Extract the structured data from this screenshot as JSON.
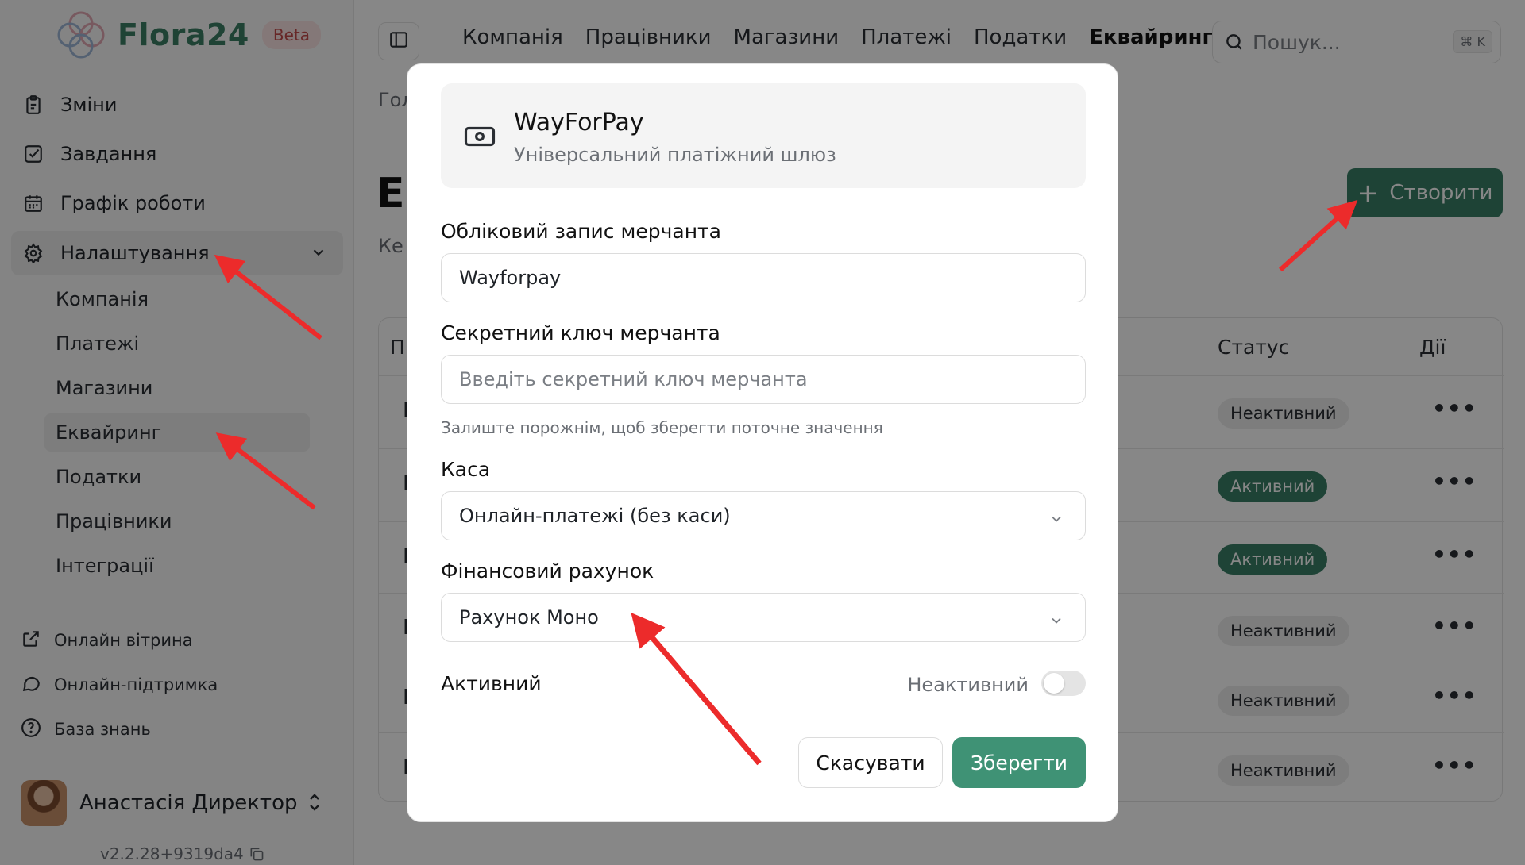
{
  "brand": {
    "name": "Flora24",
    "badge": "Beta"
  },
  "sidebar": {
    "items": [
      {
        "label": "Зміни",
        "icon": "clipboard-icon"
      },
      {
        "label": "Завдання",
        "icon": "checkbox-icon"
      },
      {
        "label": "Графік роботи",
        "icon": "calendar-icon"
      },
      {
        "label": "Налаштування",
        "icon": "gear-icon"
      }
    ],
    "subitems": [
      {
        "label": "Компанія"
      },
      {
        "label": "Платежі"
      },
      {
        "label": "Магазини"
      },
      {
        "label": "Еквайринг"
      },
      {
        "label": "Податки"
      },
      {
        "label": "Працівники"
      },
      {
        "label": "Інтеграції"
      }
    ],
    "footer": [
      {
        "label": "Онлайн вітрина",
        "icon": "external-link-icon"
      },
      {
        "label": "Онлайн-підтримка",
        "icon": "chat-bubble-icon"
      },
      {
        "label": "База знань",
        "icon": "help-circle-icon"
      }
    ],
    "user": {
      "name": "Анастасія Директор"
    },
    "version": "v2.2.28+9319da4"
  },
  "topnav": {
    "tabs": [
      "Компанія",
      "Працівники",
      "Магазини",
      "Платежі",
      "Податки",
      "Еквайринг"
    ],
    "active": "Еквайринг"
  },
  "search": {
    "placeholder": "Пошук...",
    "shortcut": "⌘ K"
  },
  "page": {
    "breadcrumb": "Гол",
    "title": "Е",
    "subtitle": "Ке",
    "create_label": "Створити"
  },
  "table": {
    "headers": {
      "first": "Пр",
      "status": "Статус",
      "actions": "Дії"
    },
    "rows": [
      {
        "first": "Е",
        "status": "Неактивний",
        "active": false
      },
      {
        "first": "Е",
        "status": "Активний",
        "active": true
      },
      {
        "first": "Е",
        "status": "Активний",
        "active": true
      },
      {
        "first": "Е",
        "status": "Неактивний",
        "active": false
      },
      {
        "first": "Е",
        "status": "Неактивний",
        "active": false
      },
      {
        "first": "Е",
        "status": "Неактивний",
        "active": false
      }
    ]
  },
  "modal": {
    "gateway": {
      "title": "WayForPay",
      "subtitle": "Універсальний платіжний шлюз",
      "icon": "banknote-icon"
    },
    "merchant_account": {
      "label": "Обліковий запис мерчанта",
      "value": "Wayforpay"
    },
    "secret_key": {
      "label": "Секретний ключ мерчанта",
      "placeholder": "Введіть секретний ключ мерчанта",
      "hint": "Залиште порожнім, щоб зберегти поточне значення"
    },
    "cash_register": {
      "label": "Каса",
      "value": "Онлайн-платежі (без каси)"
    },
    "financial_account": {
      "label": "Фінансовий рахунок",
      "value": "Рахунок Моно"
    },
    "active": {
      "label": "Активний",
      "state": "Неактивний",
      "on": false
    },
    "cancel_label": "Скасувати",
    "save_label": "Зберегти"
  },
  "colors": {
    "brand": "#3c7f64",
    "primary_button": "#3a7f66",
    "save_button": "#3f9275",
    "annotation_arrow": "#ec2b2b"
  }
}
